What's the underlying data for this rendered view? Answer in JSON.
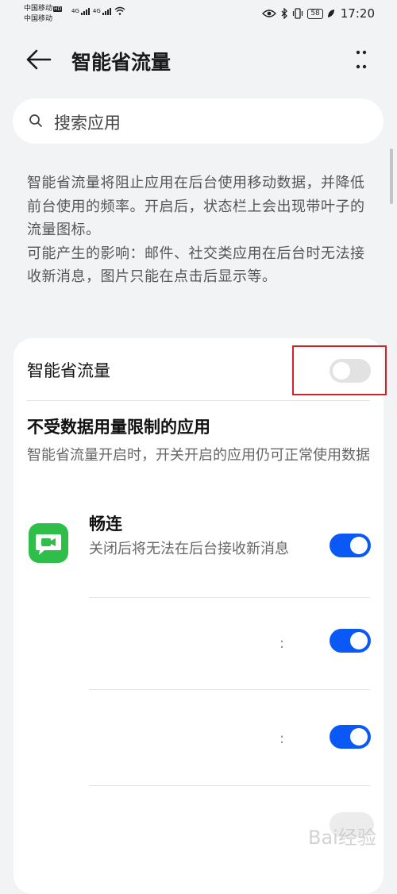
{
  "status_bar": {
    "carrier1": "中国移动",
    "carrier2": "中国移动",
    "carrier1_badge": "HD",
    "net1": "4G",
    "net2": "4G",
    "battery": "58",
    "time": "17:20"
  },
  "header": {
    "title": "智能省流量"
  },
  "search": {
    "placeholder": "搜索应用"
  },
  "description": {
    "line1": "智能省流量将阻止应用在后台使用移动数据，并降低前台使用的频率。开启后，状态栏上会出现带叶子的流量图标。",
    "line2": "可能产生的影响：邮件、社交类应用在后台时无法接收新消息，图片只能在点击后显示等。"
  },
  "main_toggle": {
    "label": "智能省流量",
    "on": false
  },
  "unrestricted": {
    "title": "不受数据用量限制的应用",
    "subtitle": "智能省流量开启时，开关开启的应用仍可正常使用数据"
  },
  "apps": [
    {
      "name": "畅连",
      "desc": "关闭后将无法在后台接收新消息",
      "on": true,
      "icon": "changlian-app-icon"
    },
    {
      "name": "",
      "desc": "",
      "suffix": ":",
      "on": true
    },
    {
      "name": "",
      "desc": "",
      "suffix": ":",
      "on": true
    },
    {
      "name": "",
      "desc": "",
      "on": false
    }
  ],
  "watermark": {
    "text": "Bai经验"
  },
  "colors": {
    "accent": "#0a59f7",
    "highlight_box": "#d3232a",
    "app_icon_bg": "#2fbe4a",
    "background": "#f1f3f5"
  }
}
